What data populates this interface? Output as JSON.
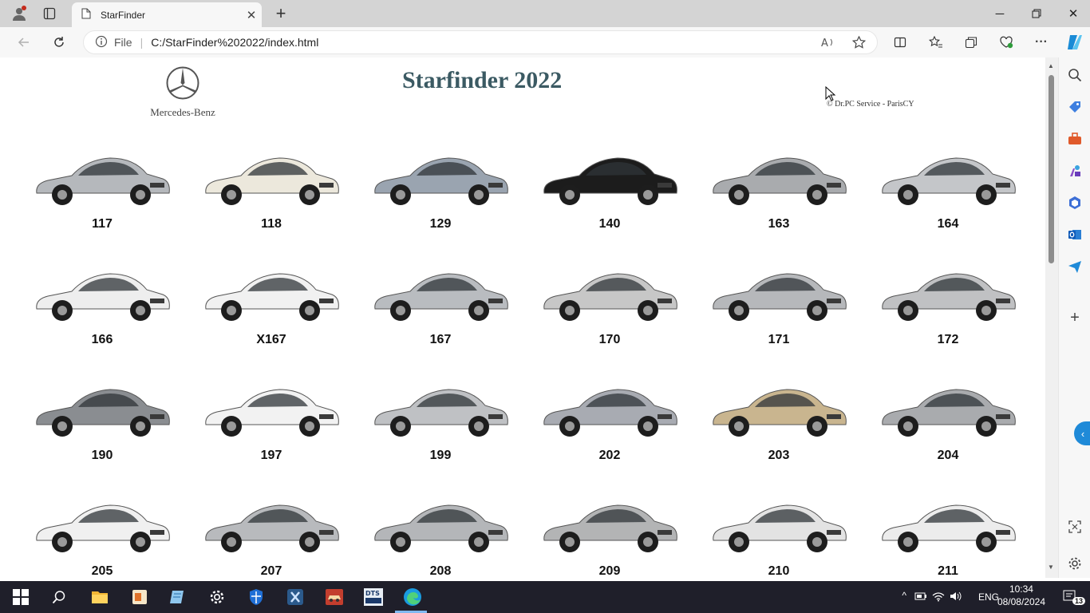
{
  "browser": {
    "tab_title": "StarFinder",
    "address_prefix": "File",
    "address": "C:/StarFinder%202022/index.html"
  },
  "page": {
    "title": "Starfinder 2022",
    "brand": "Mercedes-Benz",
    "copyright": "© Dr.PC Service - ParisCY"
  },
  "models": [
    {
      "label": "117",
      "color": "#b5b8bc"
    },
    {
      "label": "118",
      "color": "#ece8dc"
    },
    {
      "label": "129",
      "color": "#9aa4b0"
    },
    {
      "label": "140",
      "color": "#1c1c1c"
    },
    {
      "label": "163",
      "color": "#a9abae"
    },
    {
      "label": "164",
      "color": "#c4c6c9"
    },
    {
      "label": "166",
      "color": "#eeeeee"
    },
    {
      "label": "X167",
      "color": "#f1f1f1"
    },
    {
      "label": "167",
      "color": "#b9bcc0"
    },
    {
      "label": "170",
      "color": "#c7c7c7"
    },
    {
      "label": "171",
      "color": "#b6b8bb"
    },
    {
      "label": "172",
      "color": "#c0c1c3"
    },
    {
      "label": "190",
      "color": "#8a8d91"
    },
    {
      "label": "197",
      "color": "#f2f2f2"
    },
    {
      "label": "199",
      "color": "#bfc1c4"
    },
    {
      "label": "202",
      "color": "#a8abb2"
    },
    {
      "label": "203",
      "color": "#c9b58f"
    },
    {
      "label": "204",
      "color": "#a9abae"
    },
    {
      "label": "205",
      "color": "#f0f0f0"
    },
    {
      "label": "207",
      "color": "#b8babd"
    },
    {
      "label": "208",
      "color": "#b4b6b9"
    },
    {
      "label": "209",
      "color": "#b3b4b5"
    },
    {
      "label": "210",
      "color": "#e3e3e3"
    },
    {
      "label": "211",
      "color": "#ececec"
    }
  ],
  "taskbar": {
    "language": "ENG",
    "time": "10:34",
    "date": "08/08/2024",
    "notifications": "13"
  }
}
